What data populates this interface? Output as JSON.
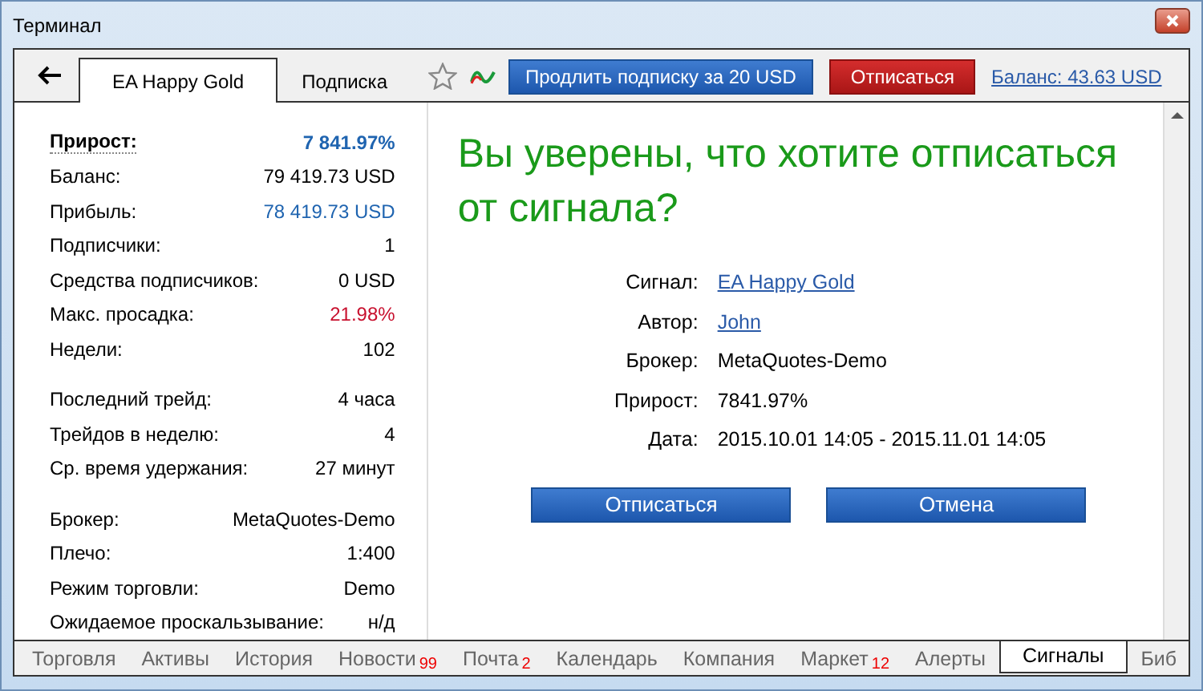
{
  "window": {
    "title": "Терминал"
  },
  "toolbar": {
    "tabs": [
      {
        "label": "EA Happy Gold",
        "selected": true
      },
      {
        "label": "Подписка",
        "selected": false
      }
    ],
    "favorite": false,
    "extend_button": "Продлить подписку за 20 USD",
    "unsubscribe_button": "Отписаться",
    "balance_link": "Баланс: 43.63 USD"
  },
  "stats": [
    [
      {
        "label": "Прирост:",
        "value": "7 841.97%",
        "kind": "headline"
      },
      {
        "label": "Баланс:",
        "value": "79 419.73 USD",
        "kind": "plain"
      },
      {
        "label": "Прибыль:",
        "value": "78 419.73 USD",
        "kind": "profit"
      },
      {
        "label": "Подписчики:",
        "value": "1",
        "kind": "plain"
      },
      {
        "label": "Средства подписчиков:",
        "value": "0 USD",
        "kind": "plain"
      },
      {
        "label": "Макс. просадка:",
        "value": "21.98%",
        "kind": "loss"
      },
      {
        "label": "Недели:",
        "value": "102",
        "kind": "plain"
      }
    ],
    [
      {
        "label": "Последний трейд:",
        "value": "4 часа",
        "kind": "plain"
      },
      {
        "label": "Трейдов в неделю:",
        "value": "4",
        "kind": "plain"
      },
      {
        "label": "Ср. время удержания:",
        "value": "27 минут",
        "kind": "plain"
      }
    ],
    [
      {
        "label": "Брокер:",
        "value": "MetaQuotes-Demo",
        "kind": "plain"
      },
      {
        "label": "Плечо:",
        "value": "1:400",
        "kind": "plain"
      },
      {
        "label": "Режим торговли:",
        "value": "Demo",
        "kind": "plain"
      },
      {
        "label": "Ожидаемое проскальзывание:",
        "value": "н/д",
        "kind": "plain"
      }
    ]
  ],
  "dialog": {
    "question": "Вы уверены, что хотите отписаться от сигнала?",
    "details": [
      {
        "label": "Сигнал:",
        "value": "EA Happy Gold",
        "kind": "link"
      },
      {
        "label": "Автор:",
        "value": "John",
        "kind": "link"
      },
      {
        "label": "Брокер:",
        "value": "MetaQuotes-Demo",
        "kind": "text"
      },
      {
        "label": "Прирост:",
        "value": "7841.97%",
        "kind": "text"
      },
      {
        "label": "Дата:",
        "value": "2015.10.01 14:05 - 2015.11.01 14:05",
        "kind": "text"
      }
    ],
    "buttons": [
      "Отписаться",
      "Отмена"
    ]
  },
  "bottom_tabs": [
    {
      "label": "Торговля",
      "selected": false
    },
    {
      "label": "Активы",
      "selected": false
    },
    {
      "label": "История",
      "selected": false
    },
    {
      "label": "Новости",
      "badge": "99",
      "selected": false
    },
    {
      "label": "Почта",
      "badge": "2",
      "selected": false
    },
    {
      "label": "Календарь",
      "selected": false
    },
    {
      "label": "Компания",
      "selected": false
    },
    {
      "label": "Маркет",
      "badge": "12",
      "selected": false
    },
    {
      "label": "Алерты",
      "selected": false
    },
    {
      "label": "Сигналы",
      "selected": true
    },
    {
      "label": "Биб",
      "selected": false
    }
  ]
}
